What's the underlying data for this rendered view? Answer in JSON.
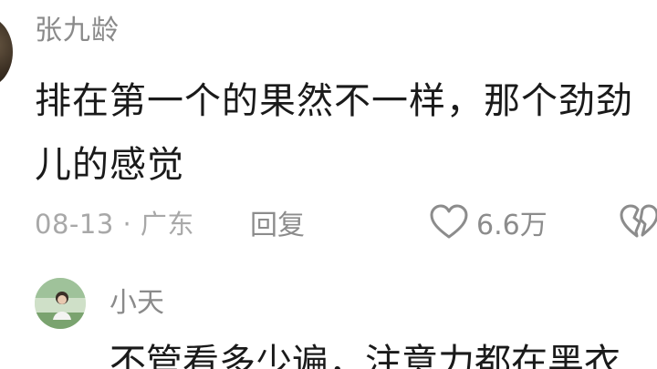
{
  "comment": {
    "username": "张九龄",
    "text_lines": [
      "排在第一个的果然不一样，那个劲劲",
      "儿的感觉"
    ],
    "date_location": "08-13 · 广东",
    "reply_label": "回复",
    "like_count": "6.6万"
  },
  "reply": {
    "username": "小天",
    "text": "不管看多少遍，注意力都在黑衣"
  },
  "icons": {
    "like": "heart-outline-icon",
    "dislike": "broken-heart-icon"
  },
  "colors": {
    "text_primary": "#1a1a1a",
    "text_secondary": "#8c8c8c"
  }
}
